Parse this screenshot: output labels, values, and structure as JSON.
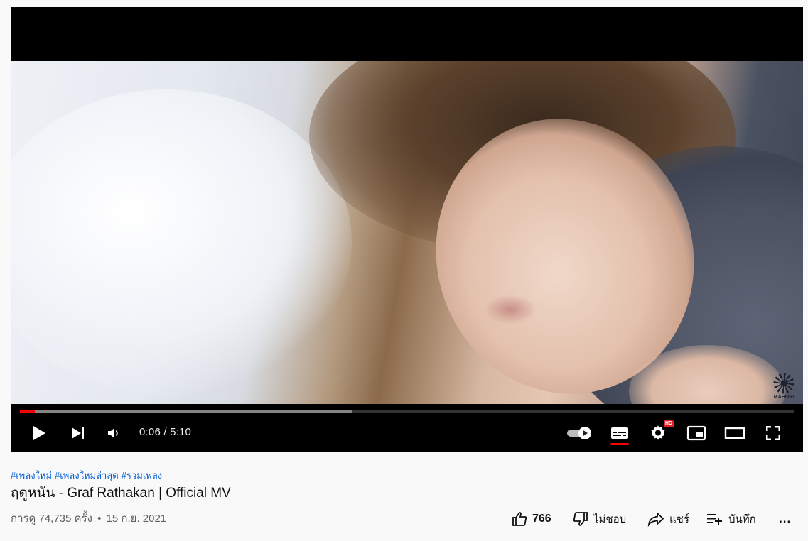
{
  "player": {
    "current_time": "0:06",
    "separator": " / ",
    "duration": "5:10",
    "played_fraction": 0.019,
    "buffered_fraction": 0.43,
    "hd_label": "HD",
    "watermark_text": "MAHORI",
    "accent_color": "#ff0000",
    "icons": [
      "play-icon",
      "next-icon",
      "volume-icon",
      "autoplay-toggle-icon",
      "subtitles-icon",
      "settings-icon",
      "miniplayer-icon",
      "theater-mode-icon",
      "fullscreen-icon"
    ]
  },
  "video": {
    "hashtags": [
      "#เพลงใหม่",
      "#เพลงใหม่ล่าสุด",
      "#รวมเพลง"
    ],
    "title": "ฤดูหนัน - Graf Rathakan | Official MV",
    "views": "การดู 74,735 ครั้ง",
    "dot": "•",
    "date": "15 ก.ย. 2021"
  },
  "actions": {
    "like_count": "766",
    "dislike_label": "ไม่ชอบ",
    "share_label": "แชร์",
    "save_label": "บันทึก",
    "more_label": "..."
  },
  "colors": {
    "link": "#065fd4",
    "text": "#0f0f0f",
    "secondary_text": "#606060"
  }
}
